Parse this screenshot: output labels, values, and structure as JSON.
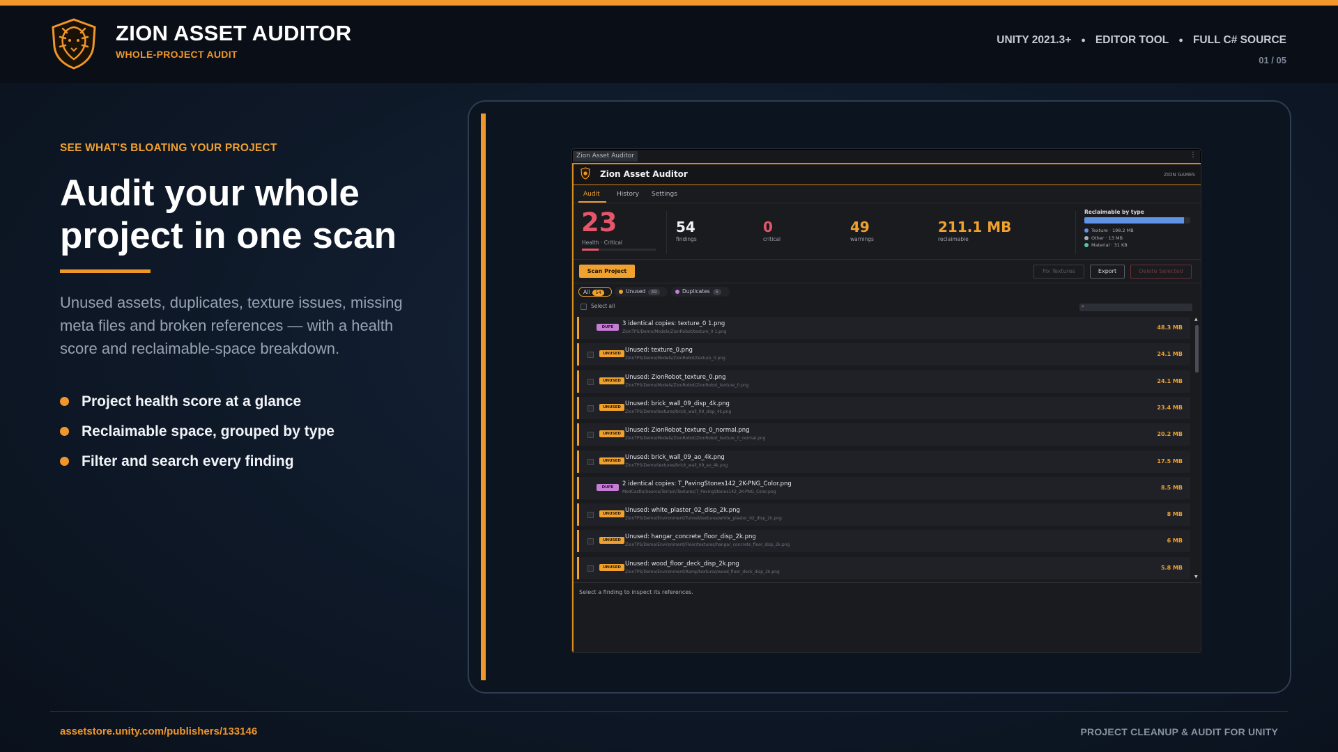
{
  "header": {
    "title": "ZION ASSET AUDITOR",
    "subtitle": "WHOLE-PROJECT AUDIT",
    "meta": [
      "UNITY 2021.3+",
      "EDITOR TOOL",
      "FULL C# SOURCE"
    ],
    "slide": "01 / 05"
  },
  "hero": {
    "eyebrow": "SEE WHAT'S BLOATING YOUR PROJECT",
    "headline": "Audit your whole project in one scan",
    "lede": "Unused assets, duplicates, texture issues, missing meta files and broken references — with a health score and reclaimable-space breakdown.",
    "bullets": [
      "Project health score at a glance",
      "Reclaimable space, grouped by type",
      "Filter and search every finding"
    ]
  },
  "window": {
    "tab": "Zion Asset Auditor",
    "app_title": "Zion Asset Auditor",
    "vendor": "ZION GAMES",
    "tabs": [
      "Audit",
      "History",
      "Settings"
    ],
    "active_tab": "Audit",
    "stats": {
      "health": "23",
      "health_label": "Health · Critical",
      "health_fraction": 0.23,
      "findings": "54",
      "findings_label": "findings",
      "critical": "0",
      "critical_label": "critical",
      "warnings": "49",
      "warnings_label": "warnings",
      "reclaimable": "211.1 MB",
      "reclaimable_label": "reclaimable"
    },
    "reclaimable_by_type": {
      "title": "Reclaimable by type",
      "texture_fraction": 0.94,
      "legend": [
        {
          "label": "Texture · 198.2 MB",
          "color": "#5e93e6"
        },
        {
          "label": "Other · 13 MB",
          "color": "#a9b1bd"
        },
        {
          "label": "Material · 31 KB",
          "color": "#4fc7b5"
        }
      ]
    },
    "actions": {
      "scan": "Scan Project",
      "fix": "Fix Textures",
      "export": "Export",
      "delete": "Delete Selected"
    },
    "filters": {
      "all": "All",
      "all_count": "54",
      "unused": "Unused",
      "unused_count": "49",
      "duplicates": "Duplicates",
      "duplicates_count": "5"
    },
    "select_all": "Select all",
    "findings": [
      {
        "type": "DUPE",
        "title": "3 identical copies: texture_0 1.png",
        "path": "ZionTPS/Demo/Models/ZionRobot/texture_0 1.png",
        "size": "48.3 MB"
      },
      {
        "type": "UNUSED",
        "title": "Unused: texture_0.png",
        "path": "ZionTPS/Demo/Models/ZionRobot/texture_0.png",
        "size": "24.1 MB"
      },
      {
        "type": "UNUSED",
        "title": "Unused: ZionRobot_texture_0.png",
        "path": "ZionTPS/Demo/Models/ZionRobot/ZionRobot_texture_0.png",
        "size": "24.1 MB"
      },
      {
        "type": "UNUSED",
        "title": "Unused: brick_wall_09_disp_4k.png",
        "path": "ZionTPS/Demo/textures/brick_wall_09_disp_4k.png",
        "size": "23.4 MB"
      },
      {
        "type": "UNUSED",
        "title": "Unused: ZionRobot_texture_0_normal.png",
        "path": "ZionTPS/Demo/Models/ZionRobot/ZionRobot_texture_0_normal.png",
        "size": "20.2 MB"
      },
      {
        "type": "UNUSED",
        "title": "Unused: brick_wall_09_ao_4k.png",
        "path": "ZionTPS/Demo/textures/brick_wall_09_ao_4k.png",
        "size": "17.5 MB"
      },
      {
        "type": "DUPE",
        "title": "2 identical copies: T_PavingStones142_2K-PNG_Color.png",
        "path": "MedCastle/Source/Terrain/Textures/T_PavingStones142_2K-PNG_Color.png",
        "size": "8.5 MB"
      },
      {
        "type": "UNUSED",
        "title": "Unused: white_plaster_02_disp_2k.png",
        "path": "ZionTPS/Demo/Environment/Tunnel/textures/white_plaster_02_disp_2k.png",
        "size": "8 MB"
      },
      {
        "type": "UNUSED",
        "title": "Unused: hangar_concrete_floor_disp_2k.png",
        "path": "ZionTPS/Demo/Environment/Floor/textures/hangar_concrete_floor_disp_2k.png",
        "size": "6 MB"
      },
      {
        "type": "UNUSED",
        "title": "Unused: wood_floor_deck_disp_2k.png",
        "path": "ZionTPS/Demo/Environment/Ramp/textures/wood_floor_deck_disp_2k.png",
        "size": "5.8 MB"
      }
    ],
    "detail_hint": "Select a finding to inspect its references."
  },
  "footer": {
    "link": "assetstore.unity.com/publishers/133146",
    "tagline": "PROJECT CLEANUP & AUDIT FOR UNITY"
  },
  "colors": {
    "accent": "#f0962a",
    "critical": "#e5566a",
    "warning": "#f0a12e",
    "dupe": "#c77dd7"
  }
}
